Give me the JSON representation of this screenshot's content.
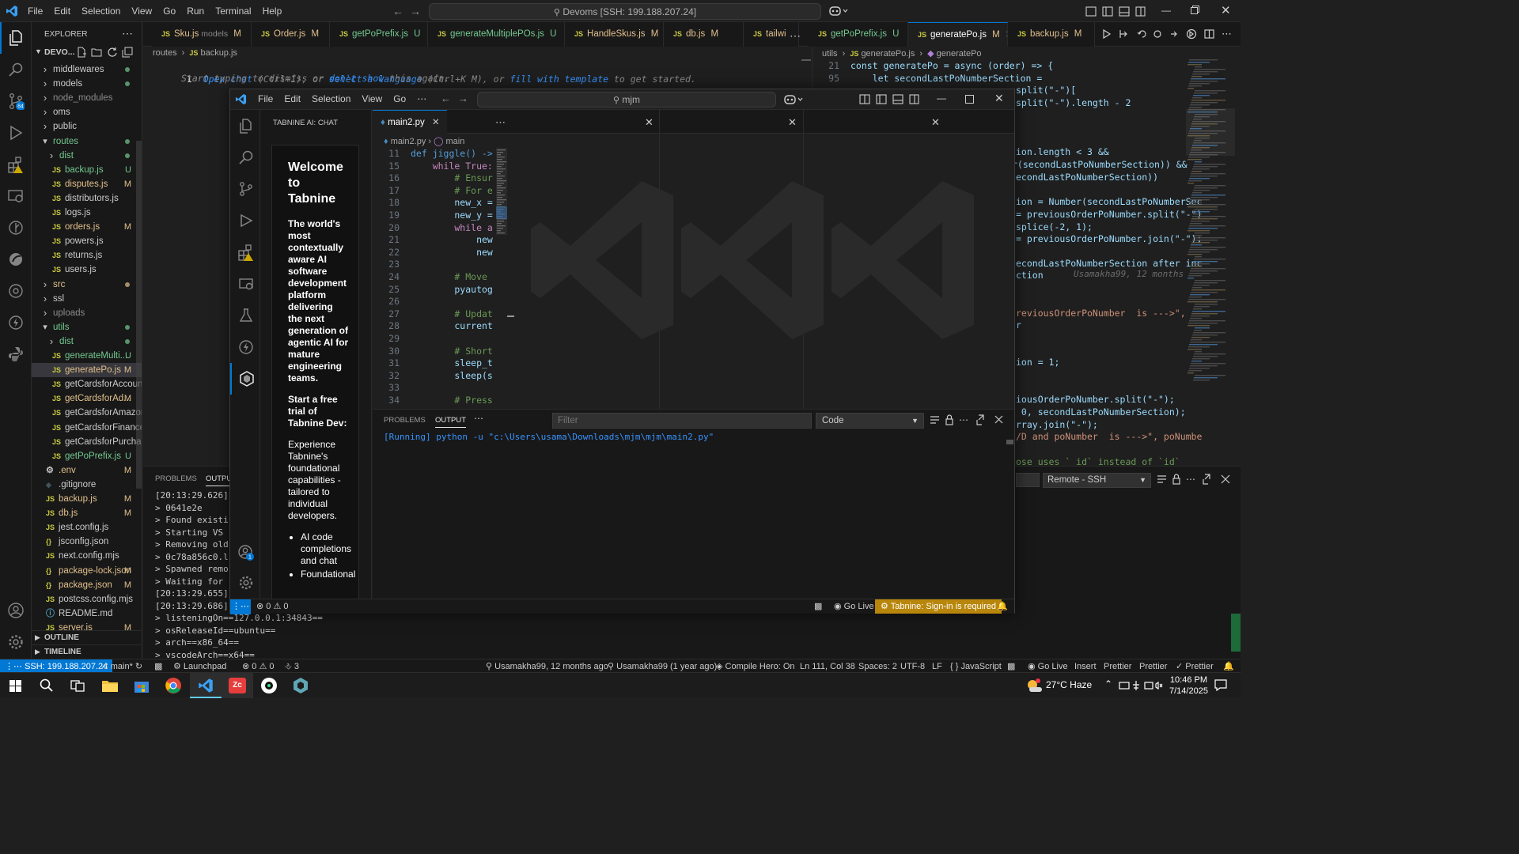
{
  "window": {
    "menu": [
      "File",
      "Edit",
      "Selection",
      "View",
      "Go",
      "Run",
      "Terminal",
      "Help"
    ],
    "command_center": "Devoms [SSH: 199.188.207.24]"
  },
  "explorer": {
    "title": "EXPLORER",
    "root": "DEVO...",
    "outline": "OUTLINE",
    "timeline": "TIMELINE",
    "items": [
      {
        "label": "middlewares",
        "type": "folder",
        "open": false,
        "depth": 1,
        "badge": "",
        "dot": true
      },
      {
        "label": "models",
        "type": "folder",
        "open": false,
        "depth": 1,
        "badge": "",
        "dot": true
      },
      {
        "label": "node_modules",
        "type": "folder",
        "open": false,
        "depth": 1,
        "badge": "",
        "dot": false,
        "dim": true
      },
      {
        "label": "oms",
        "type": "folder",
        "open": false,
        "depth": 1,
        "badge": "",
        "dot": false
      },
      {
        "label": "public",
        "type": "folder",
        "open": false,
        "depth": 1,
        "badge": "",
        "dot": false
      },
      {
        "label": "routes",
        "type": "folder",
        "open": true,
        "depth": 1,
        "badge": "",
        "dot": true,
        "color": "#73c991"
      },
      {
        "label": "dist",
        "type": "folder",
        "open": false,
        "depth": 2,
        "badge": "",
        "dot": true,
        "color": "#73c991"
      },
      {
        "label": "backup.js",
        "type": "js",
        "depth": 2,
        "badge": "U",
        "color": "#73c991"
      },
      {
        "label": "disputes.js",
        "type": "js",
        "depth": 2,
        "badge": "M",
        "color": "#e2c08d"
      },
      {
        "label": "distributors.js",
        "type": "js",
        "depth": 2,
        "badge": ""
      },
      {
        "label": "logs.js",
        "type": "js",
        "depth": 2,
        "badge": ""
      },
      {
        "label": "orders.js",
        "type": "js",
        "depth": 2,
        "badge": "M",
        "color": "#e2c08d"
      },
      {
        "label": "powers.js",
        "type": "js",
        "depth": 2,
        "badge": ""
      },
      {
        "label": "returns.js",
        "type": "js",
        "depth": 2,
        "badge": ""
      },
      {
        "label": "users.js",
        "type": "js",
        "depth": 2,
        "badge": ""
      },
      {
        "label": "src",
        "type": "folder",
        "open": false,
        "depth": 1,
        "badge": "",
        "dot": true,
        "color": "#e2c08d"
      },
      {
        "label": "ssl",
        "type": "folder",
        "open": false,
        "depth": 1,
        "badge": "",
        "dot": false
      },
      {
        "label": "uploads",
        "type": "folder",
        "open": false,
        "depth": 1,
        "badge": "",
        "dot": false,
        "dim": true
      },
      {
        "label": "utils",
        "type": "folder",
        "open": true,
        "depth": 1,
        "badge": "",
        "dot": true,
        "color": "#73c991"
      },
      {
        "label": "dist",
        "type": "folder",
        "open": false,
        "depth": 2,
        "badge": "",
        "dot": true,
        "color": "#73c991"
      },
      {
        "label": "generateMulti...",
        "type": "js",
        "depth": 2,
        "badge": "U",
        "color": "#73c991"
      },
      {
        "label": "generatePo.js",
        "type": "js",
        "depth": 2,
        "badge": "M",
        "color": "#e2c08d",
        "selected": true
      },
      {
        "label": "getCardsforAccount.js",
        "type": "js",
        "depth": 2,
        "badge": ""
      },
      {
        "label": "getCardsforAd...",
        "type": "js",
        "depth": 2,
        "badge": "M",
        "color": "#e2c08d"
      },
      {
        "label": "getCardsforAmazon.js",
        "type": "js",
        "depth": 2,
        "badge": ""
      },
      {
        "label": "getCardsforFinance.js",
        "type": "js",
        "depth": 2,
        "badge": ""
      },
      {
        "label": "getCardsforPurchasi...",
        "type": "js",
        "depth": 2,
        "badge": ""
      },
      {
        "label": "getPoPrefix.js",
        "type": "js",
        "depth": 2,
        "badge": "U",
        "color": "#73c991"
      },
      {
        "label": ".env",
        "type": "gear",
        "depth": 1,
        "badge": "M",
        "color": "#e2c08d"
      },
      {
        "label": ".gitignore",
        "type": "diamond",
        "depth": 1,
        "badge": ""
      },
      {
        "label": "backup.js",
        "type": "js",
        "depth": 1,
        "badge": "M",
        "color": "#e2c08d"
      },
      {
        "label": "db.js",
        "type": "js",
        "depth": 1,
        "badge": "M",
        "color": "#e2c08d"
      },
      {
        "label": "jest.config.js",
        "type": "js",
        "depth": 1,
        "badge": ""
      },
      {
        "label": "jsconfig.json",
        "type": "json",
        "depth": 1,
        "badge": ""
      },
      {
        "label": "next.config.mjs",
        "type": "js",
        "depth": 1,
        "badge": ""
      },
      {
        "label": "package-lock.json",
        "type": "json",
        "depth": 1,
        "badge": "M",
        "color": "#e2c08d"
      },
      {
        "label": "package.json",
        "type": "json",
        "depth": 1,
        "badge": "M",
        "color": "#e2c08d"
      },
      {
        "label": "postcss.config.mjs",
        "type": "js",
        "depth": 1,
        "badge": ""
      },
      {
        "label": "README.md",
        "type": "info",
        "depth": 1,
        "badge": ""
      },
      {
        "label": "server.js",
        "type": "js",
        "depth": 1,
        "badge": "M",
        "color": "#e2c08d"
      }
    ]
  },
  "tabs": [
    {
      "label": "Sku.js",
      "desc": "models",
      "badge": "M",
      "color": "#e2c08d"
    },
    {
      "label": "Order.js",
      "badge": "M",
      "color": "#e2c08d"
    },
    {
      "label": "getPoPrefix.js",
      "badge": "U",
      "color": "#73c991"
    },
    {
      "label": "generateMultiplePOs.js",
      "badge": "U",
      "color": "#73c991"
    },
    {
      "label": "HandleSkus.js",
      "badge": "M",
      "color": "#e2c08d"
    },
    {
      "label": "db.js",
      "badge": "M",
      "color": "#e2c08d"
    },
    {
      "label": "tailwi",
      "badge": "",
      "color": "#e2c08d"
    },
    {
      "label": "getPoPrefix.js",
      "badge": "U",
      "color": "#73c991"
    },
    {
      "label": "generatePo.js",
      "badge": "M",
      "color": "#e2c08d",
      "active": true
    },
    {
      "label": "backup.js",
      "badge": "M",
      "color": "#e2c08d"
    }
  ],
  "left_editor": {
    "breadcrumb": [
      "routes",
      "backup.js"
    ],
    "line": "1",
    "hint": {
      "a": "Open chat",
      "b": " (Ctrl+I), or ",
      "c": "select a language",
      "d": " (Ctrl+K M), or ",
      "e": "fill with template",
      "f": " to get started.",
      "g": "Start typing to dismiss or ",
      "h": "don't show",
      "i": " this again."
    }
  },
  "right_editor": {
    "breadcrumb": [
      "utils",
      "generatePo.js",
      "generatePo"
    ],
    "lines": [
      {
        "n": "21",
        "t": "const generatePo = async (order) => {"
      },
      {
        "n": "95",
        "t": "    let secondLastPoNumberSection ="
      }
    ],
    "fragments": [
      "split(\"-\")[",
      "split(\"-\").length - 2",
      "ion.length < 3 &&",
      "r(secondLastPoNumberSection)) &&",
      "econdLastPoNumberSection))",
      "ion = Number(secondLastPoNumberSec",
      "= previousOrderPoNumber.split(\"-\")",
      "splice(-2, 1);",
      "= previousOrderPoNumber.join(\"-\");",
      "econdLastPoNumberSection after inc",
      "ction",
      "reviousOrderPoNumber  is --->\",",
      "r",
      "ion = 1;",
      "iousOrderPoNumber.split(\"-\");",
      " 0, secondLastPoNumberSection);",
      "rray.join(\"-\");",
      "/D and poNumber  is --->\", poNumbe",
      "ose uses `_id` instead of `id`"
    ],
    "blame": "Usamakha99, 12 months"
  },
  "outer_panel": {
    "tabs": [
      "PROBLEMS",
      "OUTPU"
    ],
    "lines": [
      "[20:13:29.626]",
      "> 0641e2e",
      "> Found existir",
      "> Starting VS C",
      "> Removing old",
      "> 0c78a856c0.lc",
      "> Spawned remot",
      "> Waiting for s",
      "[20:13:29.655]",
      "[20:13:29.686]",
      "> listeningOn==127.0.0.1:34843==",
      "> osReleaseId==ubuntu==",
      "> arch==x86_64==",
      "> vscodeArch==x64=="
    ],
    "select": "Remote - SSH"
  },
  "inner": {
    "menu": [
      "File",
      "Edit",
      "Selection",
      "View",
      "Go"
    ],
    "search": "mjm",
    "chat": {
      "title": "TABNINE AI: CHAT",
      "heading": "Welcome to Tabnine",
      "intro": "The world's most contextually aware AI software development platform delivering the next generation of agentic AI for mature engineering teams.",
      "trial": "Start a free trial of Tabnine Dev:",
      "body": "Experience Tabnine's foundational capabilities - tailored to individual developers.",
      "bullets": [
        "AI code completions and chat",
        "Foundational"
      ]
    },
    "editor_tab": "main2.py",
    "breadcrumb": [
      "main2.py",
      "main"
    ],
    "code": [
      {
        "n": "11",
        "t": "def jiggle() ->"
      },
      {
        "n": "15",
        "t": "    while True:"
      },
      {
        "n": "16",
        "t": "        # Ensur"
      },
      {
        "n": "17",
        "t": "        # For e"
      },
      {
        "n": "18",
        "t": "        new_x ="
      },
      {
        "n": "19",
        "t": "        new_y ="
      },
      {
        "n": "20",
        "t": "        while a"
      },
      {
        "n": "21",
        "t": "            new"
      },
      {
        "n": "22",
        "t": "            new"
      },
      {
        "n": "23",
        "t": ""
      },
      {
        "n": "24",
        "t": "        # Move"
      },
      {
        "n": "25",
        "t": "        pyautog"
      },
      {
        "n": "26",
        "t": ""
      },
      {
        "n": "27",
        "t": "        # Updat"
      },
      {
        "n": "28",
        "t": "        current"
      },
      {
        "n": "29",
        "t": ""
      },
      {
        "n": "30",
        "t": "        # Short"
      },
      {
        "n": "31",
        "t": "        sleep_t"
      },
      {
        "n": "32",
        "t": "        sleep(s"
      },
      {
        "n": "33",
        "t": ""
      },
      {
        "n": "34",
        "t": "        # Press"
      }
    ],
    "panel": {
      "tabs": [
        "PROBLEMS",
        "OUTPUT"
      ],
      "filter_placeholder": "Filter",
      "select": "Code",
      "running": "[Running]",
      "cmd": " python -u \"c:\\Users\\usama\\Downloads\\mjm\\mjm\\main2.py\""
    },
    "status": {
      "errors": "0",
      "warnings": "0",
      "golive": "Go Live",
      "tabnine": "Tabnine: Sign-in is required"
    }
  },
  "statusbar": {
    "remote": "SSH: 199.188.207.24",
    "branch": "main*",
    "launchpad": "Launchpad",
    "errors": "0",
    "warnings": "0",
    "ports": "3",
    "blame1": "Usamakha99, 12 months ago",
    "blame2": "Usamakha99 (1 year ago)",
    "compile": "Compile Hero: On",
    "pos": "Ln 111, Col 38",
    "spaces": "Spaces: 2",
    "enc": "UTF-8",
    "eol": "LF",
    "lang": "JavaScript",
    "golive": "Go Live",
    "insert": "Insert",
    "prettier1": "Prettier",
    "prettier2": "Prettier",
    "prettier3": "Prettier"
  },
  "taskbar": {
    "weather": "27°C  Haze",
    "time": "10:46 PM",
    "date": "7/14/2025"
  },
  "colors": {
    "accent": "#0078d4",
    "modified": "#e2c08d",
    "untracked": "#73c991",
    "tabnine": "#b8860b"
  }
}
